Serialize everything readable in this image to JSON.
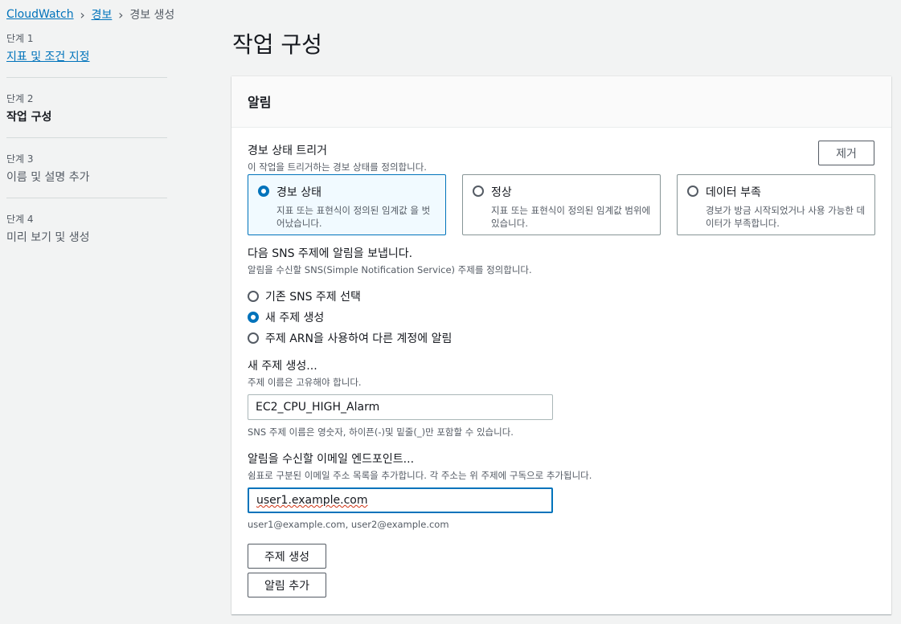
{
  "breadcrumb": {
    "items": [
      "CloudWatch",
      "경보"
    ],
    "current": "경보 생성"
  },
  "steps": [
    {
      "num": "단계 1",
      "label": "지표 및 조건 지정"
    },
    {
      "num": "단계 2",
      "label": "작업 구성"
    },
    {
      "num": "단계 3",
      "label": "이름 및 설명 추가"
    },
    {
      "num": "단계 4",
      "label": "미리 보기 및 생성"
    }
  ],
  "page_title": "작업 구성",
  "panel": {
    "title": "알림",
    "remove_label": "제거",
    "trigger": {
      "label": "경보 상태 트리거",
      "description": "이 작업을 트리거하는 경보 상태를 정의합니다.",
      "options": [
        {
          "title": "경보 상태",
          "desc": "지표 또는 표현식이 정의된 임계값 을 벗어났습니다.",
          "selected": true
        },
        {
          "title": "정상",
          "desc": "지표 또는 표현식이 정의된 임계값 범위에 있습니다.",
          "selected": false
        },
        {
          "title": "데이터 부족",
          "desc": "경보가 방금 시작되었거나 사용 가능한 데이터가 부족합니다.",
          "selected": false
        }
      ]
    },
    "sns": {
      "label": "다음 SNS 주제에 알림을 보냅니다.",
      "description": "알림을 수신할 SNS(Simple Notification Service) 주제를 정의합니다.",
      "options": [
        {
          "label": "기존 SNS 주제 선택",
          "selected": false
        },
        {
          "label": "새 주제 생성",
          "selected": true
        },
        {
          "label": "주제 ARN을 사용하여 다른 계정에 알림",
          "selected": false
        }
      ]
    },
    "topic": {
      "label": "새 주제 생성...",
      "description": "주제 이름은 고유해야 합니다.",
      "value": "EC2_CPU_HIGH_Alarm",
      "constraint": "SNS 주제 이름은 영숫자, 하이픈(-)및 밑줄(_)만 포함할 수 있습니다."
    },
    "email": {
      "label": "알림을 수신할 이메일 엔드포인트...",
      "description": "쉼표로 구분된 이메일 주소 목록을 추가합니다. 각 주소는 위 주제에 구독으로 추가됩니다.",
      "value": "user1.example.com",
      "hint": "user1@example.com, user2@example.com"
    },
    "create_topic_label": "주제 생성",
    "add_notification_label": "알림 추가"
  },
  "colors": {
    "link": "#0073bb",
    "selected_tile_bg": "#f1faff",
    "page_bg": "#f2f3f3"
  }
}
